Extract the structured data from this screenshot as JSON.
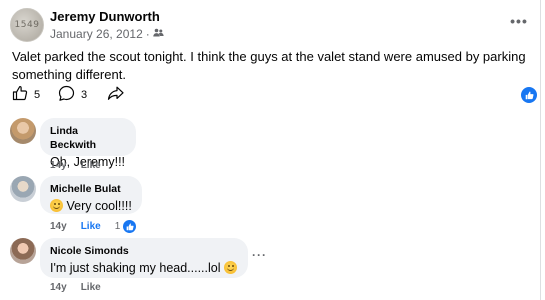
{
  "post": {
    "author": "Jeremy Dunworth",
    "date": "January 26, 2012",
    "audience_icon": "friends-icon",
    "text": "Valet parked the scout tonight. I think the guys at the valet stand were amused by parking something different.",
    "avatar_text": "1549",
    "likes": "5",
    "comments": "3",
    "more_icon": "more-horizontal-icon"
  },
  "comments": [
    {
      "name": "Linda Beckwith",
      "text": "Oh, Jeremy!!!",
      "age": "14y",
      "like_label": "Like"
    },
    {
      "name": "Michelle Bulat",
      "text": "Very cool!!!!",
      "age": "14y",
      "like_label": "Like",
      "reaction_count": "1"
    },
    {
      "name": "Nicole Simonds",
      "text": "I'm just shaking my head......lol",
      "age": "14y",
      "like_label": "Like"
    }
  ],
  "colors": {
    "accent": "#1877f2",
    "secondary_text": "#65676b",
    "bubble": "#f0f2f5"
  }
}
